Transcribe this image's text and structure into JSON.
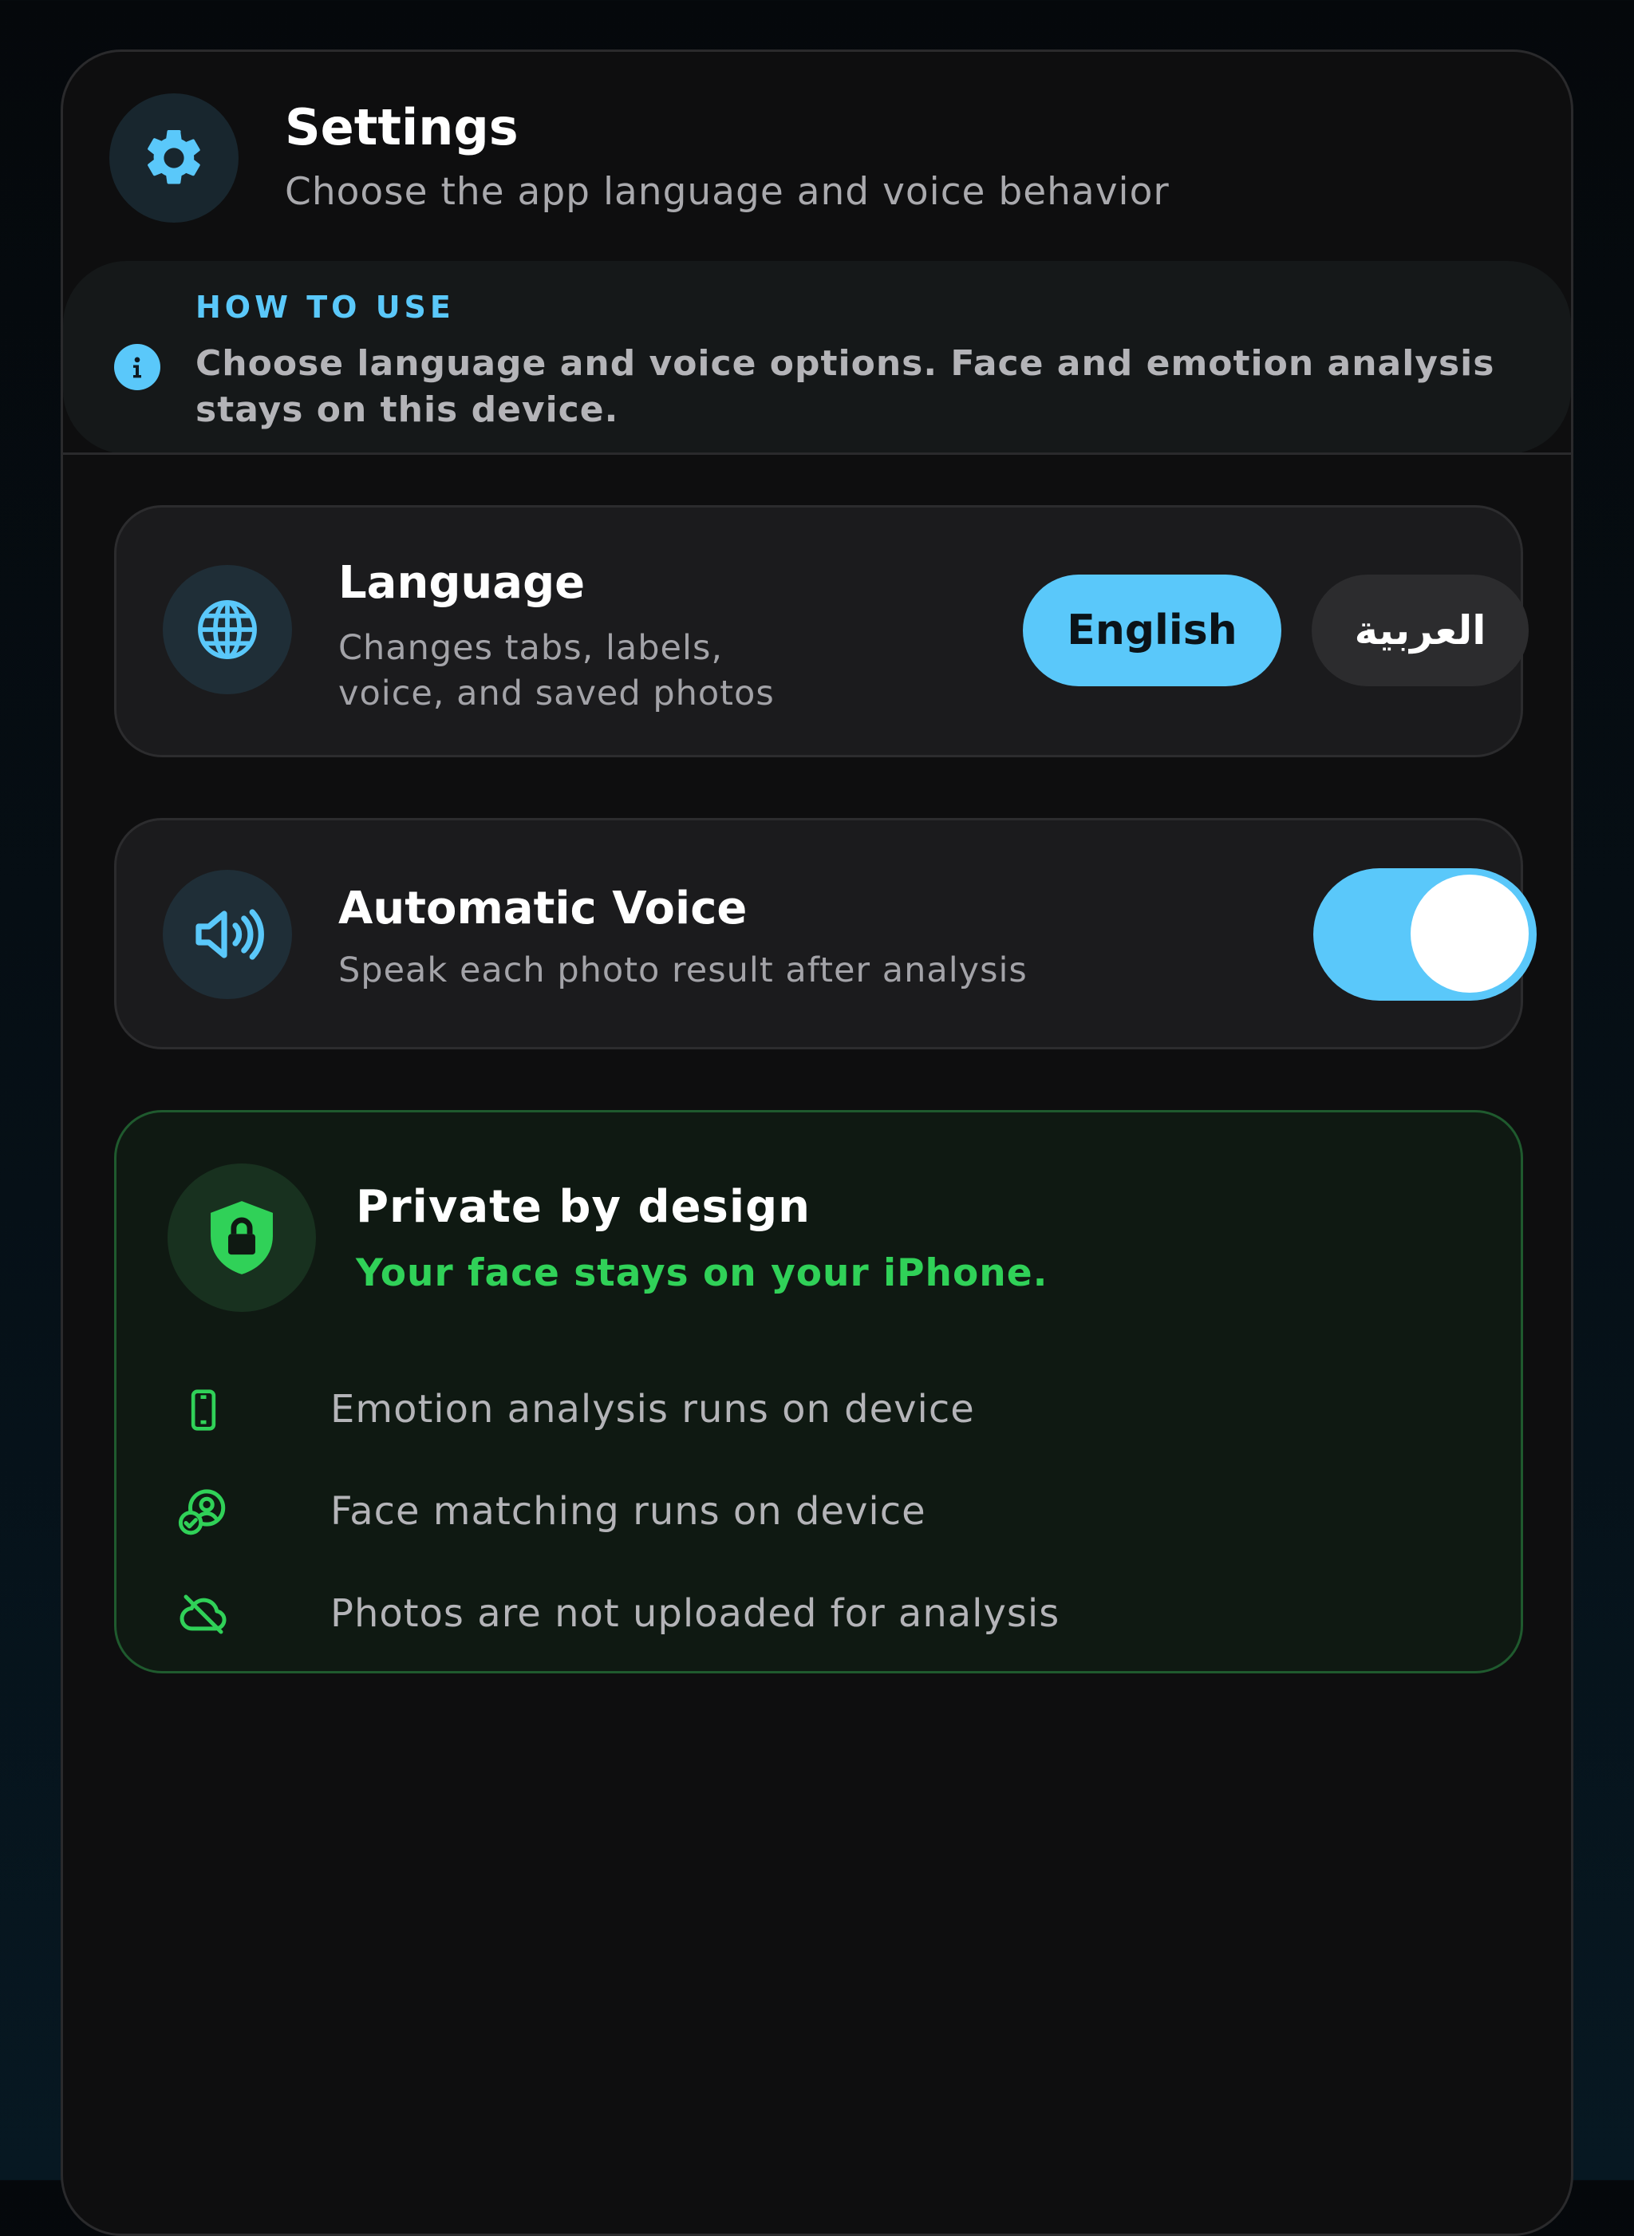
{
  "header": {
    "icon": "gear-icon",
    "title": "Settings",
    "subtitle": "Choose the app language and voice behavior"
  },
  "how_to_use": {
    "icon": "info-icon",
    "label": "HOW TO USE",
    "text": "Choose language and voice options. Face and emotion analysis stays on this device."
  },
  "language_card": {
    "icon": "globe-icon",
    "title": "Language",
    "subtitle": "Changes tabs, labels, voice, and saved photos",
    "options": [
      "English",
      "العربية"
    ],
    "selected": "English"
  },
  "voice_card": {
    "icon": "speaker-wave-icon",
    "title": "Automatic Voice",
    "subtitle": "Speak each photo result after analysis",
    "toggle_on": true
  },
  "privacy_card": {
    "icon": "shield-lock-icon",
    "title": "Private by design",
    "subtitle": "Your face stays on your iPhone.",
    "items": [
      {
        "icon": "phone-icon",
        "text": "Emotion analysis runs on device"
      },
      {
        "icon": "face-check-icon",
        "text": "Face matching runs on device"
      },
      {
        "icon": "cloud-slash-icon",
        "text": "Photos are not uploaded for analysis"
      }
    ]
  },
  "colors": {
    "accent": "#5ac8fa",
    "success": "#30d158",
    "background": "#0e0e0f",
    "card": "#1b1b1d"
  }
}
